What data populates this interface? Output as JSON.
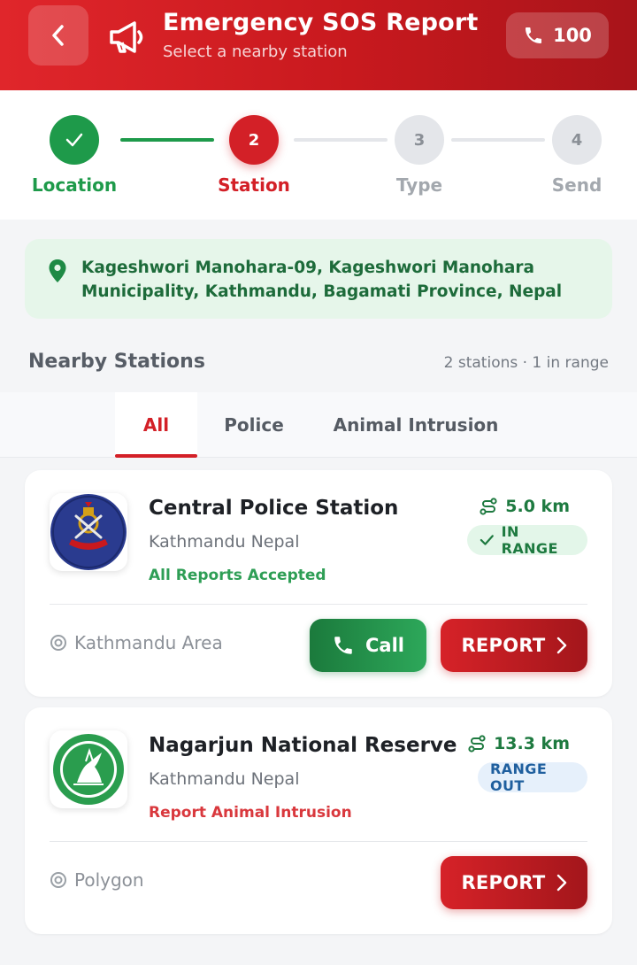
{
  "header": {
    "title": "Emergency SOS Report",
    "subtitle": "Select a nearby station",
    "call_number": "100"
  },
  "stepper": {
    "current": 2,
    "steps": [
      {
        "number": "✓",
        "label": "Location",
        "state": "done"
      },
      {
        "number": "2",
        "label": "Station",
        "state": "active"
      },
      {
        "number": "3",
        "label": "Type",
        "state": "pending"
      },
      {
        "number": "4",
        "label": "Send",
        "state": "pending"
      }
    ]
  },
  "location": {
    "address": "Kageshwori Manohara-09, Kageshwori Manohara Municipality, Kathmandu, Bagamati Province, Nepal"
  },
  "stations_section": {
    "title": "Nearby Stations",
    "summary": "2 stations · 1 in range"
  },
  "tabs": [
    {
      "label": "All",
      "active": true
    },
    {
      "label": "Police",
      "active": false
    },
    {
      "label": "Animal Intrusion",
      "active": false
    }
  ],
  "stations": [
    {
      "name": "Central Police Station",
      "address": "Kathmandu Nepal",
      "status": "All Reports Accepted",
      "distance": "5.0 km",
      "range": "IN RANGE",
      "area": "Kathmandu Area",
      "call_label": "Call",
      "report_label": "REPORT"
    },
    {
      "name": "Nagarjun National Reserve",
      "address": "Kathmandu Nepal",
      "status": "Report Animal Intrusion",
      "distance": "13.3 km",
      "range": "RANGE OUT",
      "area": "Polygon",
      "report_label": "REPORT"
    }
  ],
  "colors": {
    "primary_red": "#d32027",
    "success_green": "#1e9a4a",
    "pending_gray": "#e4e6ea",
    "range_out_blue": "#1f5f9e"
  }
}
